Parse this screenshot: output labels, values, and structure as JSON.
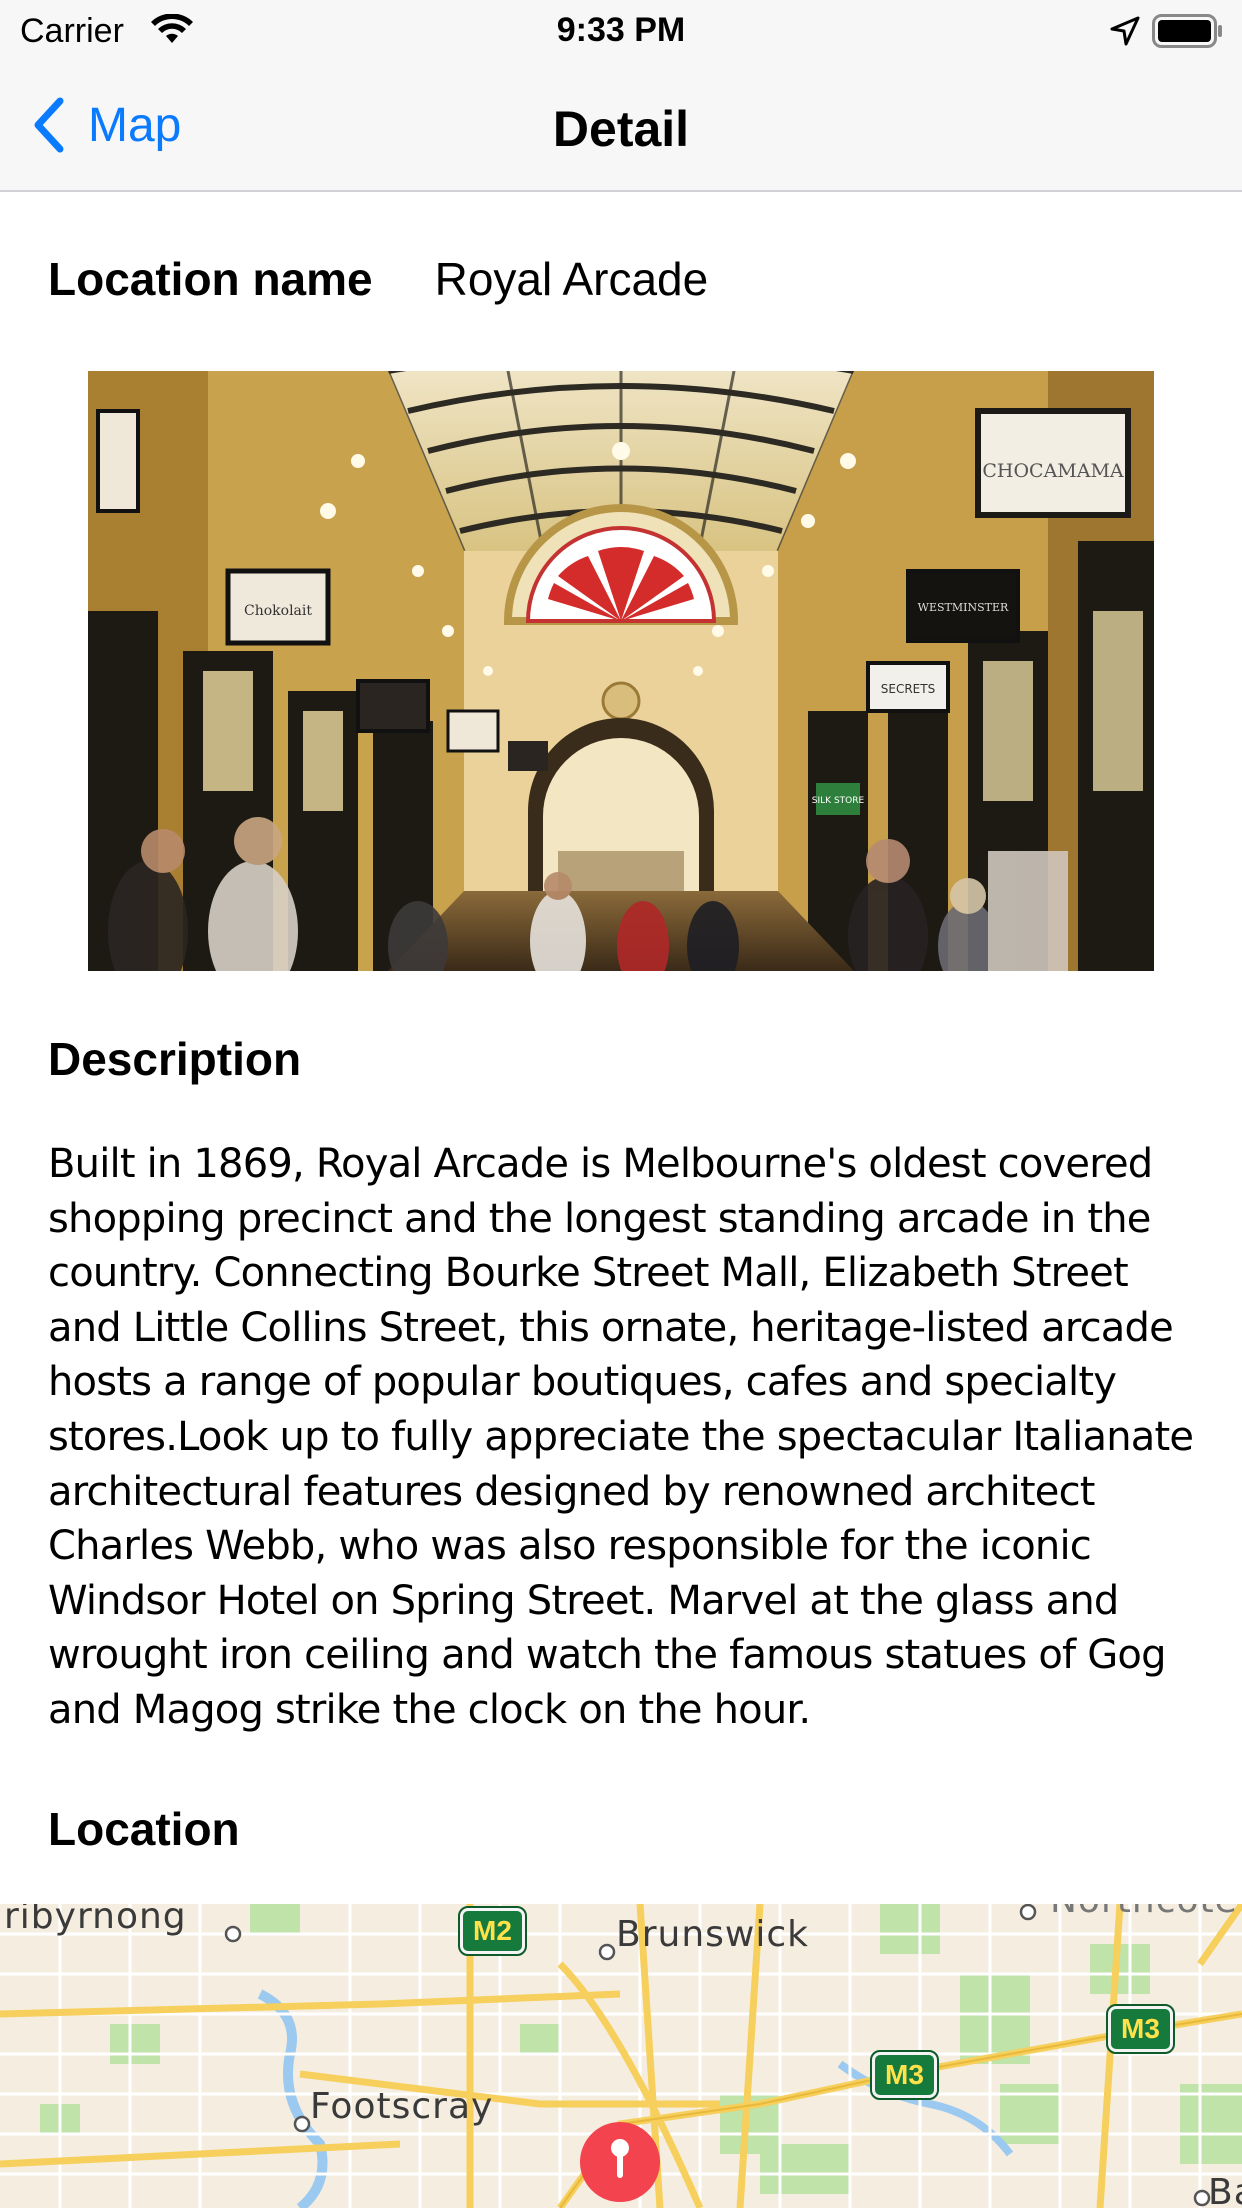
{
  "status_bar": {
    "carrier": "Carrier",
    "time": "9:33 PM"
  },
  "nav": {
    "back_label": "Map",
    "title": "Detail"
  },
  "detail": {
    "name_label": "Location name",
    "name_value": "Royal Arcade",
    "description_heading": "Description",
    "description": "Built in 1869, Royal Arcade is Melbourne's oldest covered shopping precinct and the longest standing arcade in the country. Connecting Bourke Street Mall, Elizabeth Street and Little Collins Street, this ornate, heritage-listed arcade hosts a range of popular boutiques, cafes and specialty stores.Look up to fully appreciate the spectacular Italianate architectural features designed by renowned architect Charles Webb, who was also responsible for the iconic Windsor Hotel on Spring Street. Marvel at the glass and wrought iron ceiling and watch the famous statues of Gog and Magog strike the clock on the hour.",
    "location_heading": "Location"
  },
  "photo_signs": {
    "chocamama": "CHOCAMAMA",
    "westminster": "WESTMINSTER",
    "secrets": "SECRETS",
    "silk_store": "SILK STORE",
    "chokolait": "Chokolait"
  },
  "map": {
    "labels": {
      "maribyrnong": "ribyrnong",
      "brunswick": "Brunswick",
      "footscray": "Footscray",
      "northcote": "Northcote",
      "edge_label": "Ba"
    },
    "shields": {
      "m2": "M2",
      "m3_a": "M3",
      "m3_b": "M3"
    }
  },
  "colors": {
    "accent": "#0a7aff",
    "pin": "#f2434f",
    "shield": "#167a3c"
  }
}
